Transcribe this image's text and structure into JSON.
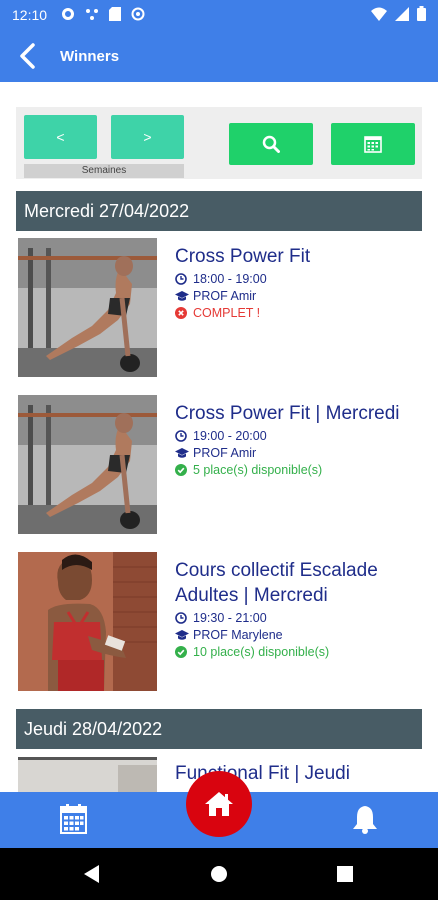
{
  "status": {
    "time": "12:10"
  },
  "header": {
    "title": "Winners"
  },
  "toolbar": {
    "prev_label": "<",
    "next_label": ">",
    "weeks_label": "Semaines"
  },
  "days": [
    {
      "label": "Mercredi 27/04/2022",
      "courses": [
        {
          "title": "Cross Power Fit",
          "time": "18:00 - 19:00",
          "coach": "PROF Amir",
          "status": "COMPLET !",
          "status_type": "full"
        },
        {
          "title": "Cross Power Fit | Mercredi",
          "time": "19:00 - 20:00",
          "coach": "PROF Amir",
          "status": "5 place(s) disponible(s)",
          "status_type": "available"
        },
        {
          "title": "Cours collectif Escalade Adultes | Mercredi",
          "time": "19:30 - 21:00",
          "coach": "PROF Marylene",
          "status": "10 place(s) disponible(s)",
          "status_type": "available"
        }
      ]
    },
    {
      "label": "Jeudi 28/04/2022",
      "courses": [
        {
          "title": "Functional Fit | Jeudi"
        }
      ]
    }
  ],
  "colors": {
    "primary": "#3f7fe8",
    "teal": "#3ed3a8",
    "green": "#1fd16a",
    "day_header": "#485c65",
    "title": "#1f2d8a",
    "full": "#e53935",
    "available": "#34b04b",
    "fab": "#d9040f"
  },
  "icons": {
    "back": "arrow-left-icon",
    "search": "search-icon",
    "calendar": "calendar-icon",
    "home": "home-icon",
    "bell": "bell-icon"
  }
}
